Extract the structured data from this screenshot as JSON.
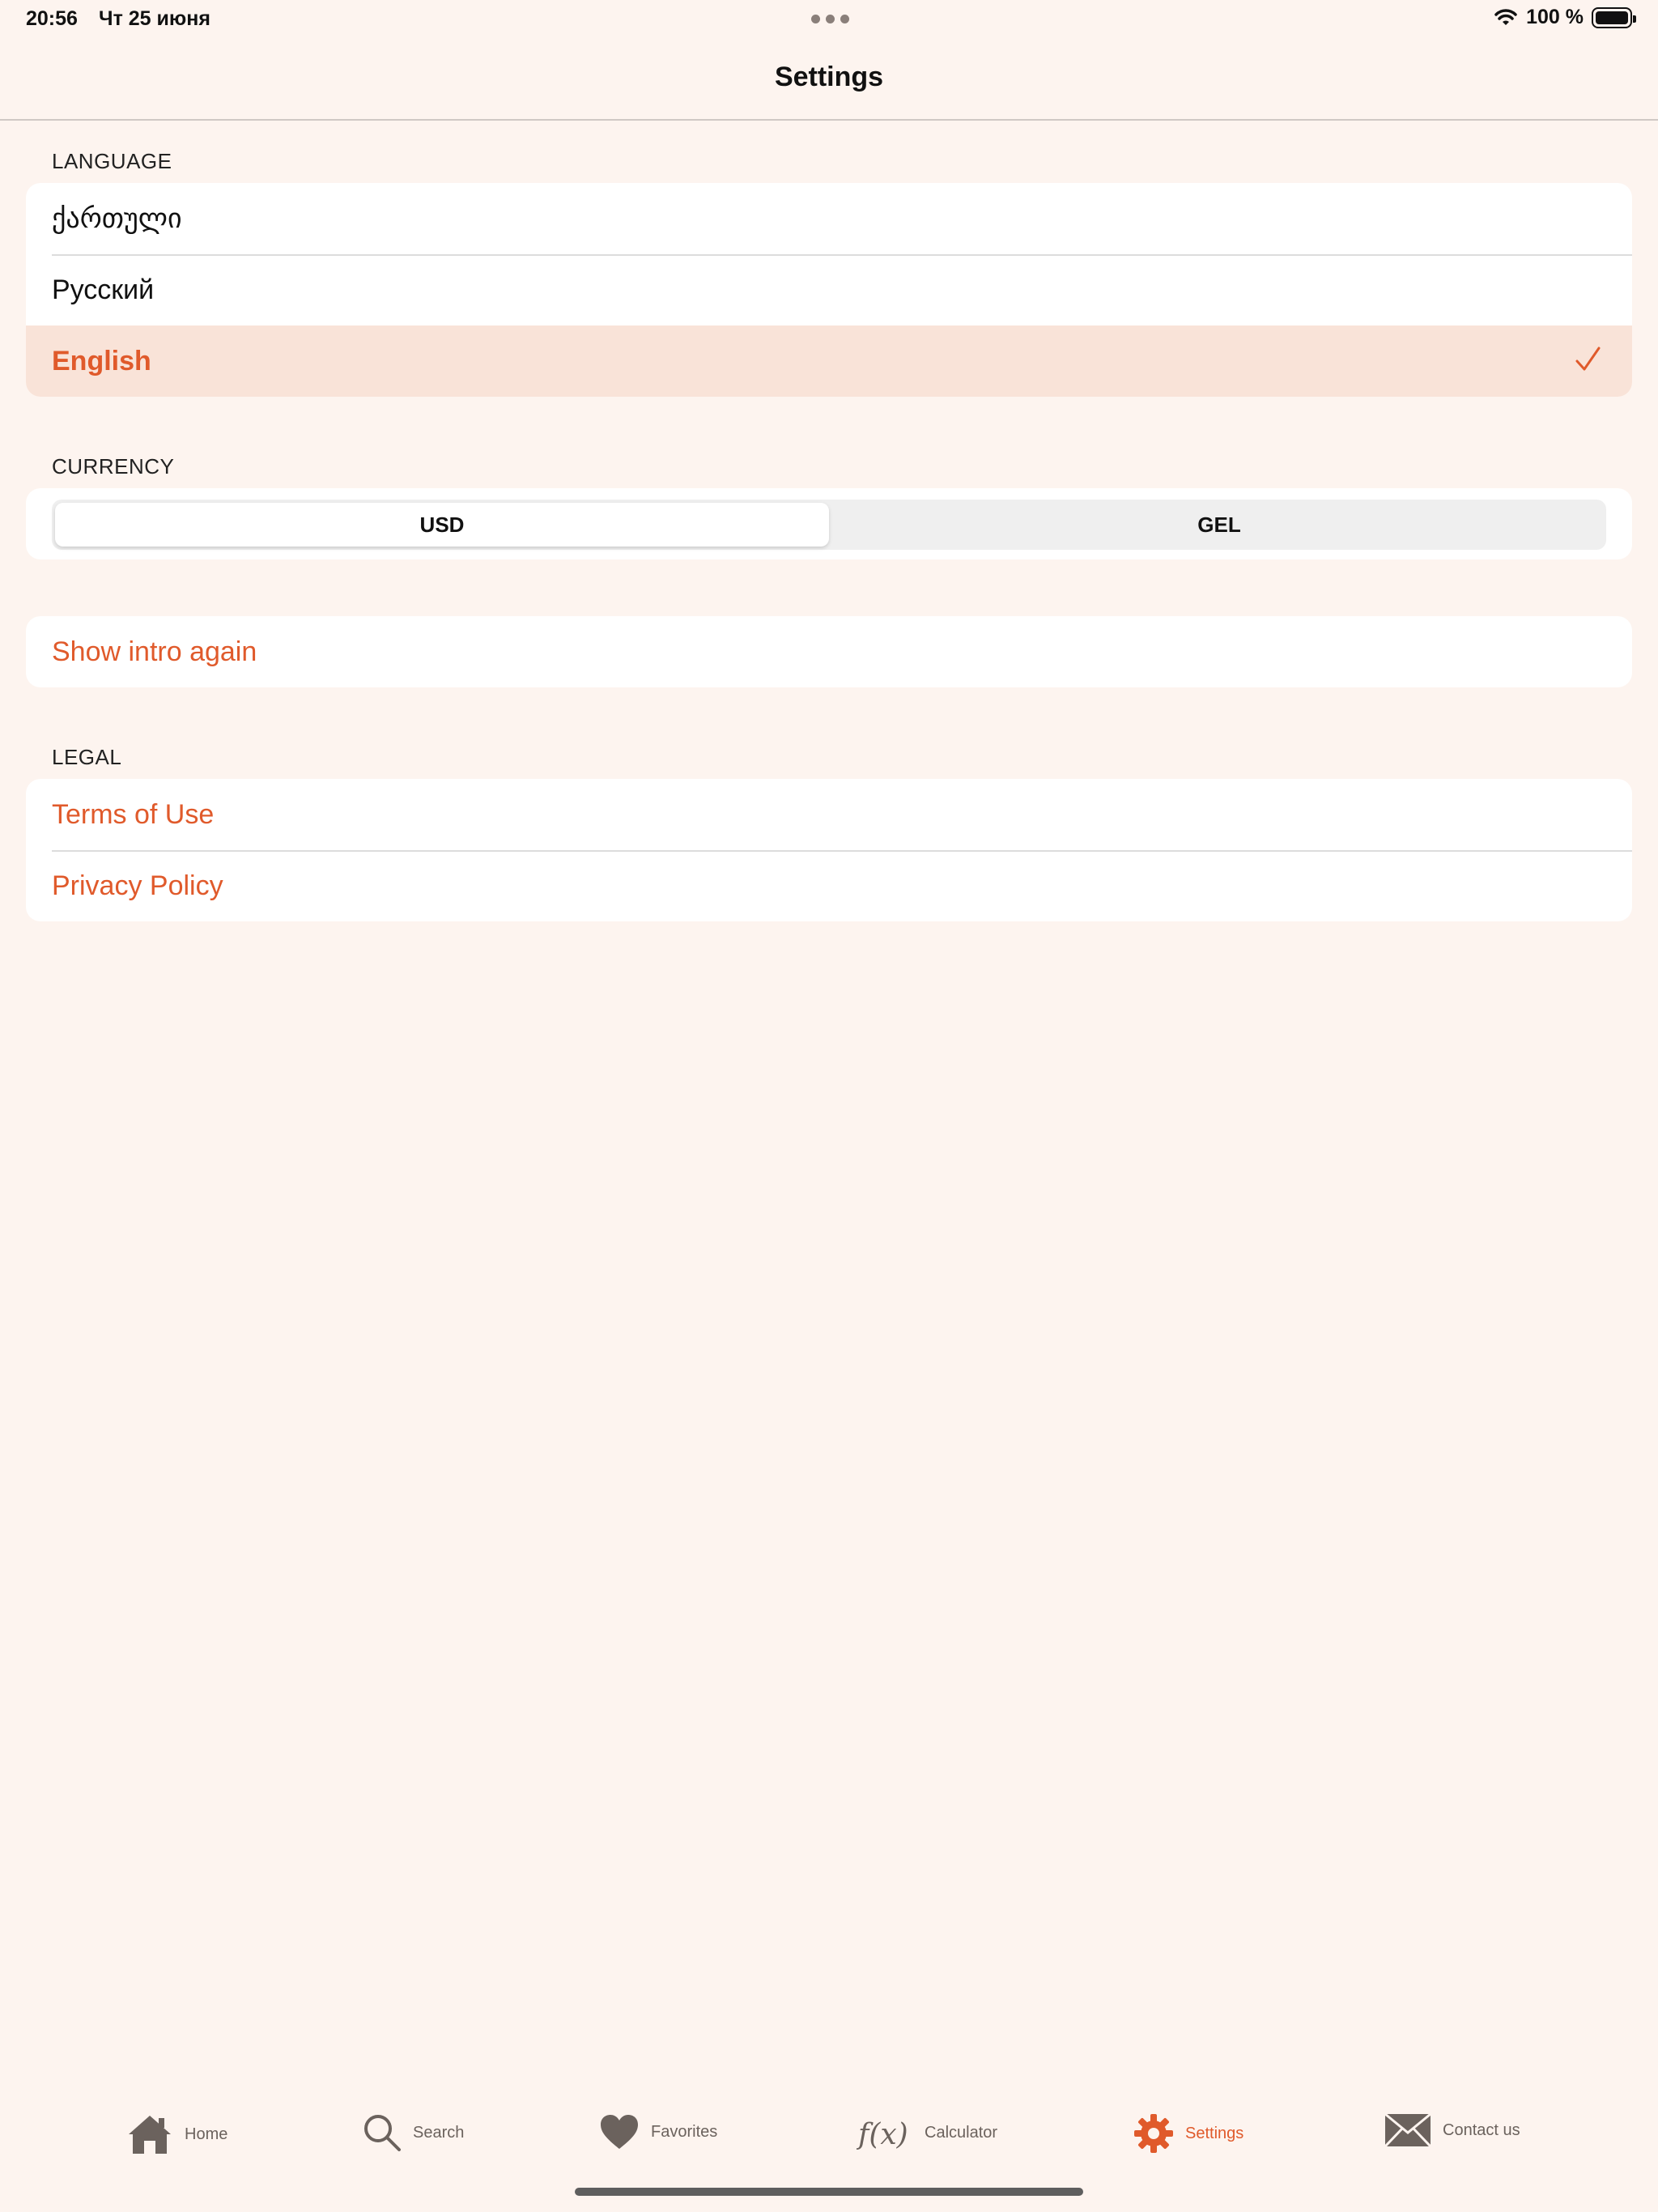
{
  "status": {
    "time": "20:56",
    "date": "Чт 25 июня",
    "battery": "100 %",
    "wifi_icon": "wifi-icon",
    "battery_icon": "battery-icon"
  },
  "nav": {
    "title": "Settings"
  },
  "language": {
    "header": "LANGUAGE",
    "items": [
      {
        "label": "ქართული",
        "selected": false
      },
      {
        "label": "Русский",
        "selected": false
      },
      {
        "label": "English",
        "selected": true
      }
    ]
  },
  "currency": {
    "header": "CURRENCY",
    "options": [
      "USD",
      "GEL"
    ],
    "selected": "USD"
  },
  "intro": {
    "label": "Show intro again"
  },
  "legal": {
    "header": "LEGAL",
    "items": [
      {
        "label": "Terms of Use"
      },
      {
        "label": "Privacy Policy"
      }
    ]
  },
  "tabs": [
    {
      "label": "Home",
      "icon": "home-icon"
    },
    {
      "label": "Search",
      "icon": "search-icon"
    },
    {
      "label": "Favorites",
      "icon": "heart-icon"
    },
    {
      "label": "Calculator",
      "icon": "function-icon"
    },
    {
      "label": "Settings",
      "icon": "gear-icon",
      "active": true
    },
    {
      "label": "Contact us",
      "icon": "envelope-icon"
    }
  ],
  "colors": {
    "accent": "#e05a2b",
    "background": "#fdf4ef",
    "selected_row": "#f9e3d8",
    "tab_inactive": "#6b625d"
  }
}
